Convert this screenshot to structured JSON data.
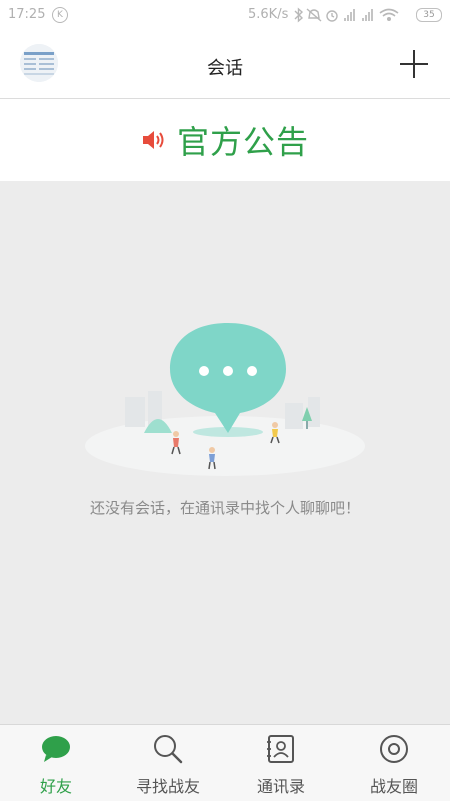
{
  "status_bar": {
    "time": "17:25",
    "k_badge": "K",
    "net_speed": "5.6K/s",
    "battery": "35"
  },
  "header": {
    "title": "会话"
  },
  "notice": {
    "text": "官方公告"
  },
  "empty_state": {
    "message": "还没有会话，在通讯录中找个人聊聊吧！"
  },
  "tabs": [
    {
      "label": "好友",
      "icon": "chat-bubble-icon"
    },
    {
      "label": "寻找战友",
      "icon": "search-icon"
    },
    {
      "label": "通讯录",
      "icon": "contacts-icon"
    },
    {
      "label": "战友圈",
      "icon": "circle-icon"
    }
  ],
  "colors": {
    "accent": "#2fa04a",
    "speaker": "#e74c3c",
    "bubble": "#7fd6c8"
  }
}
